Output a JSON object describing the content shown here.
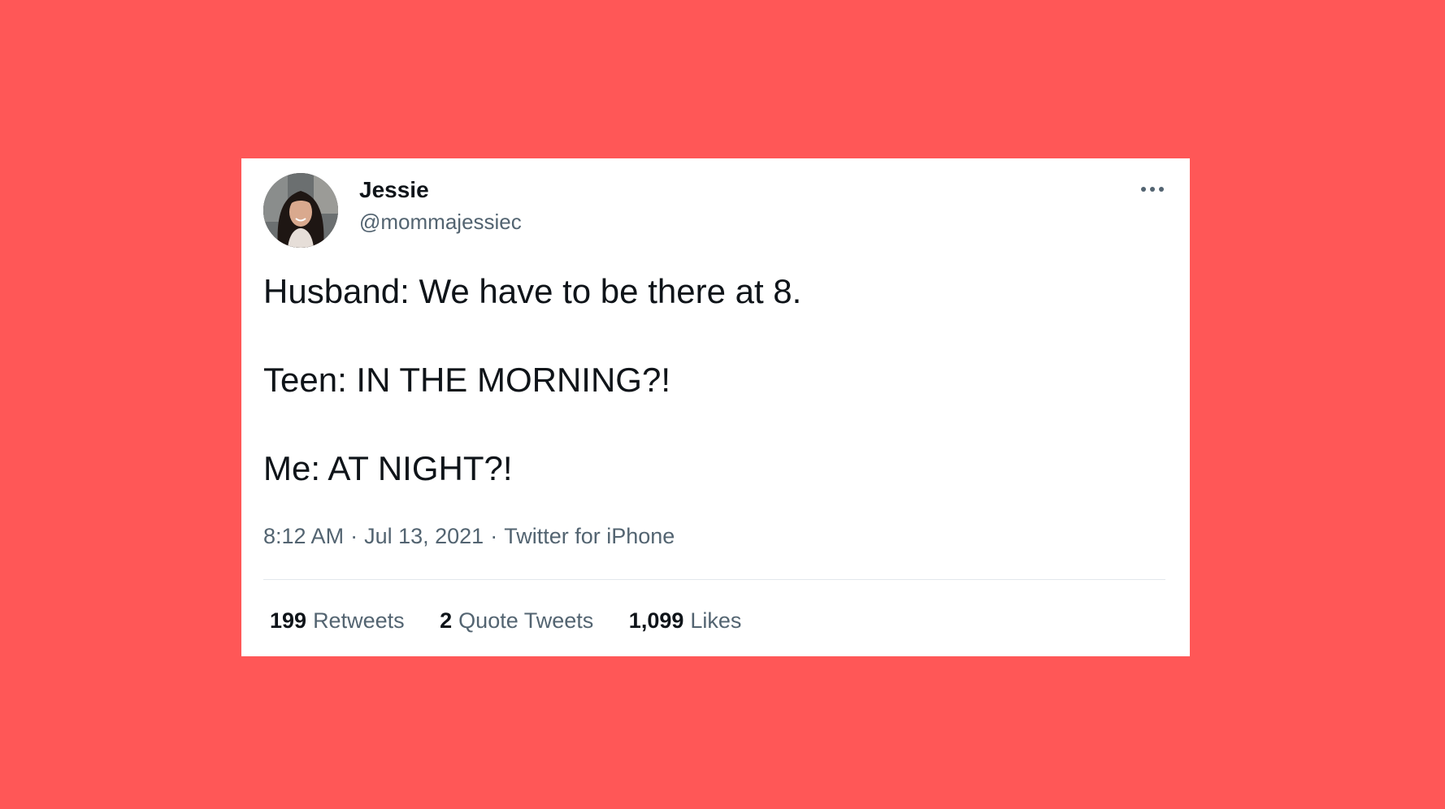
{
  "colors": {
    "background": "#FF5757",
    "card": "#FFFFFF",
    "text_primary": "#0F1419",
    "text_secondary": "#536471",
    "divider": "#E3E8EC"
  },
  "author": {
    "name": "Jessie",
    "handle": "@mommajessiec"
  },
  "tweet": {
    "lines": [
      "Husband: We have to be there at 8.",
      "Teen: IN THE MORNING?!",
      "Me: AT NIGHT?!"
    ]
  },
  "meta": {
    "time": "8:12 AM",
    "separator": "·",
    "date": "Jul 13, 2021",
    "source": "Twitter for iPhone"
  },
  "stats": [
    {
      "count": "199",
      "label": "Retweets"
    },
    {
      "count": "2",
      "label": "Quote Tweets"
    },
    {
      "count": "1,099",
      "label": "Likes"
    }
  ],
  "icons": {
    "more": "more-horizontal-icon",
    "avatar": "profile-photo"
  }
}
